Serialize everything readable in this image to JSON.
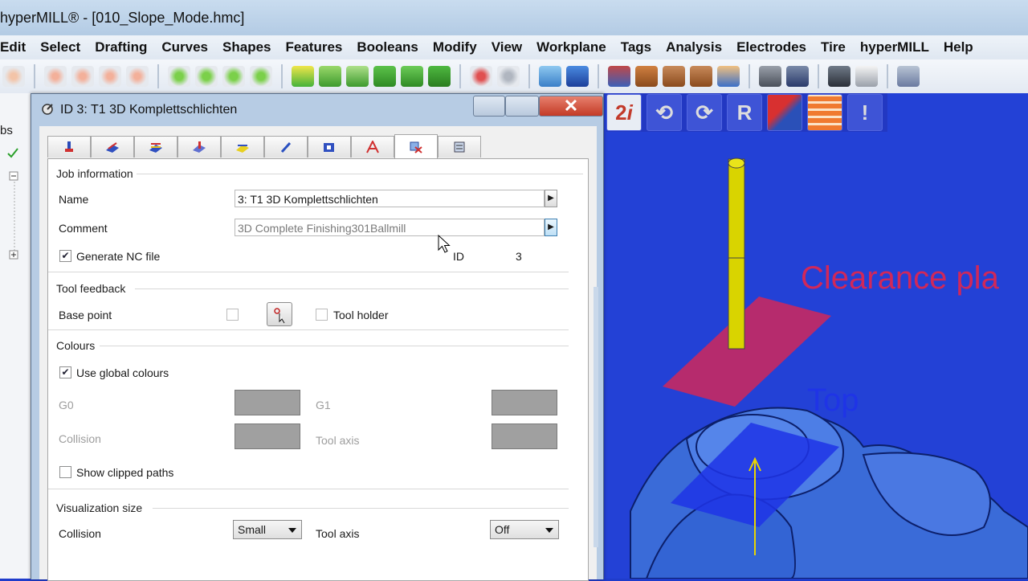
{
  "app": {
    "title": "hyperMILL® - [010_Slope_Mode.hmc]"
  },
  "menu": [
    "Edit",
    "Select",
    "Drafting",
    "Curves",
    "Shapes",
    "Features",
    "Booleans",
    "Modify",
    "View",
    "Workplane",
    "Tags",
    "Analysis",
    "Electrodes",
    "Tire",
    "hyperMILL",
    "Help"
  ],
  "left_panel": {
    "tab_label": "bs"
  },
  "viewport": {
    "label_clearance": "Clearance pla",
    "label_top": "Top"
  },
  "dialog": {
    "title": "ID 3: T1 3D Komplettschlichten",
    "close_glyph": "✕",
    "job_information": {
      "heading": "Job information",
      "name_label": "Name",
      "name_value": "3: T1 3D Komplettschlichten",
      "comment_label": "Comment",
      "comment_value": "3D Complete Finishing301Ballmill",
      "generate_nc_label": "Generate NC file",
      "generate_nc_checked": true,
      "id_label": "ID",
      "id_value": "3"
    },
    "tool_feedback": {
      "heading": "Tool feedback",
      "base_point_label": "Base point",
      "base_point_checked": false,
      "tool_holder_label": "Tool holder",
      "tool_holder_checked": false
    },
    "colours": {
      "heading": "Colours",
      "use_global_label": "Use global colours",
      "use_global_checked": true,
      "g0_label": "G0",
      "g1_label": "G1",
      "collision_label": "Collision",
      "tool_axis_label": "Tool axis",
      "swatch_color": "#a0a0a0",
      "show_clipped_label": "Show clipped paths",
      "show_clipped_checked": false
    },
    "visualization": {
      "heading": "Visualization size",
      "collision_label": "Collision",
      "collision_value": "Small",
      "tool_axis_label": "Tool axis",
      "tool_axis_value": "Off"
    }
  },
  "colors": {
    "viewport_bg": "#2341d6",
    "clearance_plane": "#d0285a",
    "top_plane": "#1f34e6",
    "tool_yellow": "#d9d400"
  }
}
